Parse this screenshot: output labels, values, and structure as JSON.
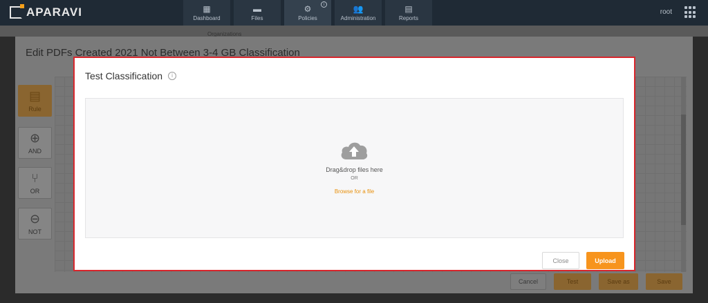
{
  "app": {
    "logo_text": "APARAVI"
  },
  "nav": {
    "items": [
      {
        "label": "Dashboard",
        "icon": "dashboard-icon"
      },
      {
        "label": "Files",
        "icon": "folder-icon"
      },
      {
        "label": "Policies",
        "icon": "gear-icon"
      },
      {
        "label": "Administration",
        "icon": "users-icon"
      },
      {
        "label": "Reports",
        "icon": "report-icon"
      }
    ],
    "active": "Policies"
  },
  "user": {
    "name": "root"
  },
  "background_dialog": {
    "title": "Edit PDFs Created 2021 Not Between 3-4 GB Classification",
    "under_text": "Organizations",
    "tools": [
      {
        "label": "Rule",
        "icon": "clipboard-icon"
      },
      {
        "label": "AND",
        "icon": "plus-circle-icon"
      },
      {
        "label": "OR",
        "icon": "fork-icon"
      },
      {
        "label": "NOT",
        "icon": "minus-circle-icon"
      }
    ],
    "buttons": {
      "cancel": "Cancel",
      "test": "Test",
      "save_as": "Save as",
      "save": "Save"
    }
  },
  "modal": {
    "title": "Test Classification",
    "dropzone": {
      "main": "Drag&drop files here",
      "or": "OR",
      "browse": "Browse for a file"
    },
    "buttons": {
      "close": "Close",
      "upload": "Upload"
    }
  },
  "colors": {
    "accent": "#f7941d",
    "highlight_border": "#d9262c",
    "nav_bg": "#1f2a35"
  }
}
